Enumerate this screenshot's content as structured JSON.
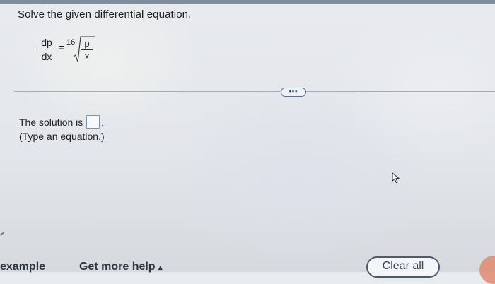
{
  "question": {
    "title": "Solve the given differential equation."
  },
  "equation": {
    "lhs_numerator": "dp",
    "lhs_denominator": "dx",
    "equals": "=",
    "coefficient": "16",
    "rhs_numerator": "p",
    "rhs_denominator": "x"
  },
  "more_button": {
    "label": "•••"
  },
  "answer": {
    "prefix": "The solution is",
    "suffix": ".",
    "hint": "(Type an equation.)"
  },
  "footer": {
    "example_label": "example",
    "help_label": "Get more help",
    "help_caret": "▴",
    "clear_label": "Clear all"
  },
  "icons": {
    "cursor": "mouse-pointer-icon"
  }
}
